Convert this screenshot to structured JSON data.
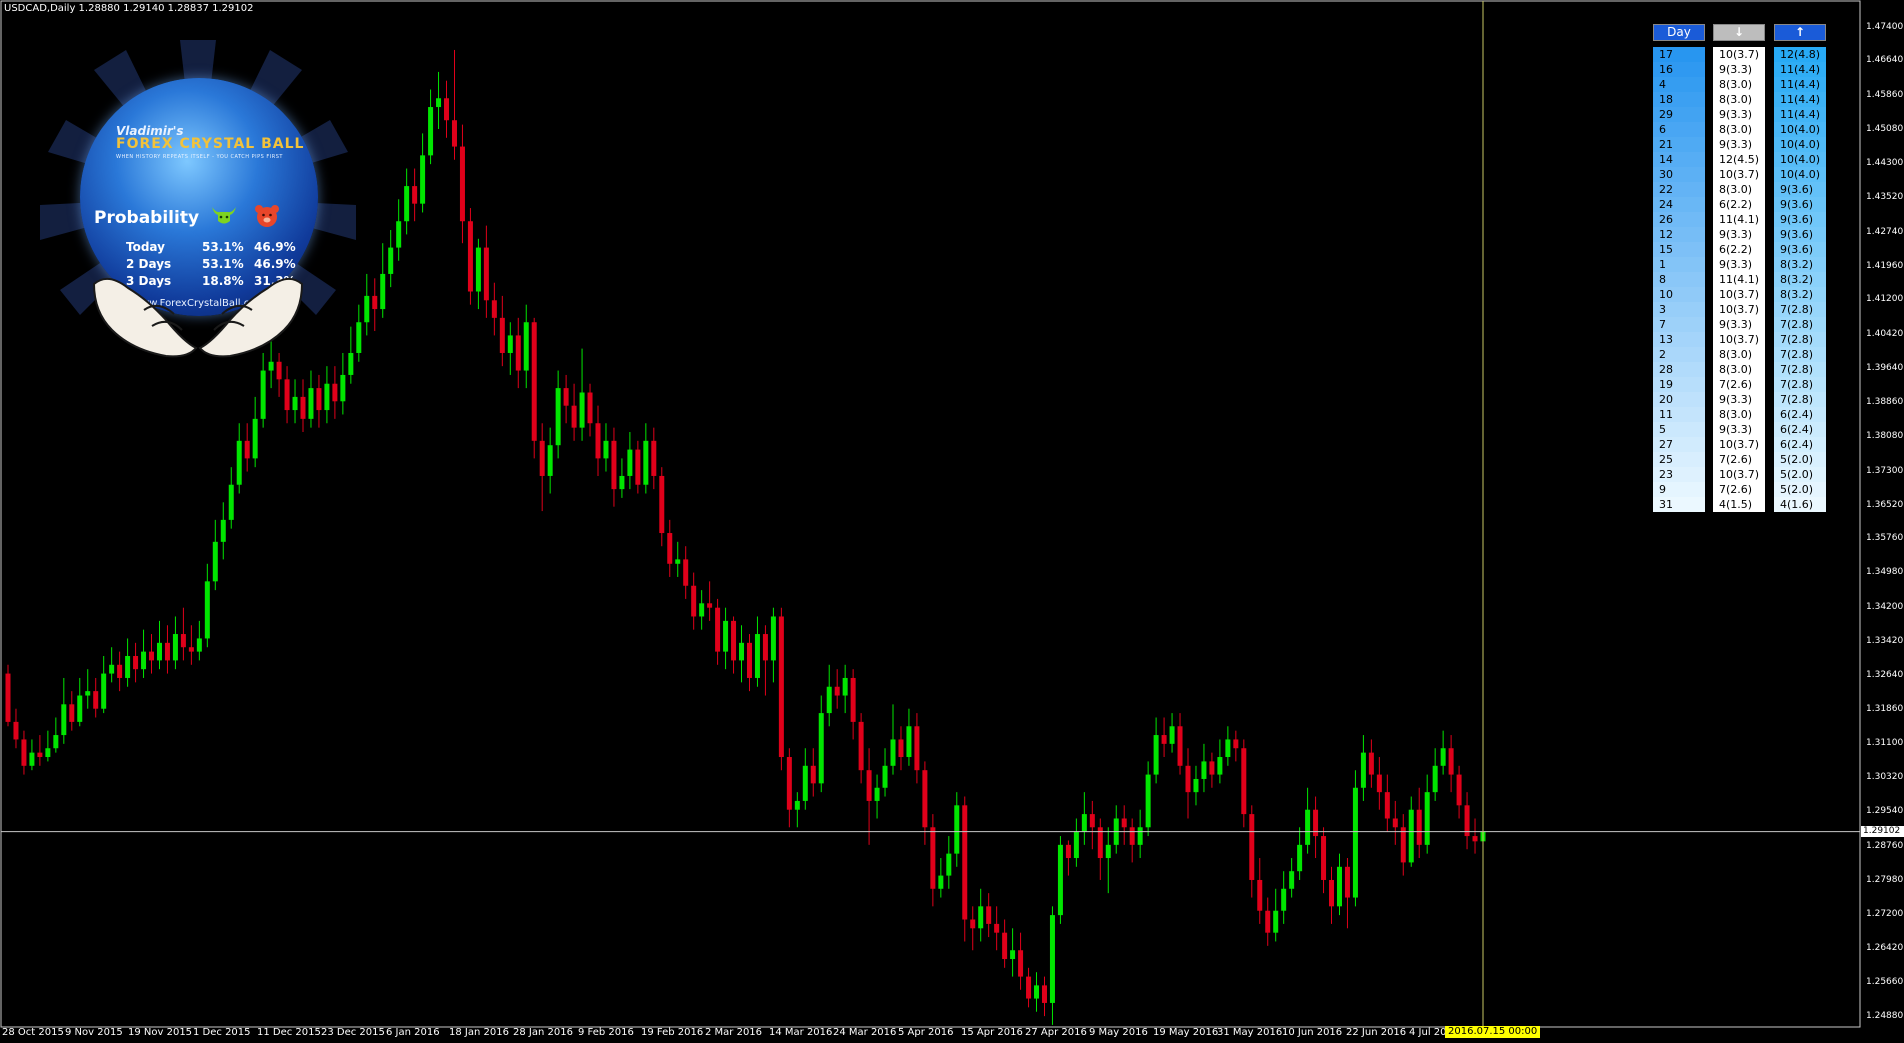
{
  "chart_title": "USDCAD,Daily  1.28880 1.29140 1.28837 1.29102",
  "chart_data": {
    "type": "candlestick",
    "symbol": "USDCAD",
    "timeframe": "Daily",
    "ohlc_header": {
      "open": 1.2888,
      "high": 1.2914,
      "low": 1.28837,
      "close": 1.29102
    },
    "y_ticks": [
      "1.47400",
      "1.46640",
      "1.45860",
      "1.45080",
      "1.44300",
      "1.43520",
      "1.42740",
      "1.41960",
      "1.41200",
      "1.40420",
      "1.39640",
      "1.38860",
      "1.38080",
      "1.37300",
      "1.36520",
      "1.35760",
      "1.34980",
      "1.34200",
      "1.33420",
      "1.32640",
      "1.31860",
      "1.31100",
      "1.30320",
      "1.29540",
      "1.28760",
      "1.27980",
      "1.27200",
      "1.26420",
      "1.25660",
      "1.24880"
    ],
    "ylim": [
      1.2425,
      1.478
    ],
    "x_labels": [
      "28 Oct 2015",
      "9 Nov 2015",
      "19 Nov 2015",
      "1 Dec 2015",
      "11 Dec 2015",
      "23 Dec 2015",
      "6 Jan 2016",
      "18 Jan 2016",
      "28 Jan 2016",
      "9 Feb 2016",
      "19 Feb 2016",
      "2 Mar 2016",
      "14 Mar 2016",
      "24 Mar 2016",
      "5 Apr 2016",
      "15 Apr 2016",
      "27 Apr 2016",
      "9 May 2016",
      "19 May 2016",
      "31 May 2016",
      "10 Jun 2016",
      "22 Jun 2016",
      "4 Jul 20"
    ],
    "current_price_label": "1.29102",
    "current_time_label": "2016.07.15 00:00",
    "colors": {
      "bull": "#00e600",
      "bear": "#e0001a",
      "grid": "#c8c8c8",
      "crosshair": "#c8c864"
    },
    "candles": [
      [
        1.327,
        1.316,
        1.329,
        1.315
      ],
      [
        1.316,
        1.312,
        1.319,
        1.31
      ],
      [
        1.312,
        1.306,
        1.314,
        1.304
      ],
      [
        1.306,
        1.309,
        1.312,
        1.305
      ],
      [
        1.309,
        1.308,
        1.313,
        1.306
      ],
      [
        1.308,
        1.31,
        1.314,
        1.307
      ],
      [
        1.31,
        1.313,
        1.317,
        1.309
      ],
      [
        1.313,
        1.32,
        1.326,
        1.311
      ],
      [
        1.32,
        1.316,
        1.323,
        1.314
      ],
      [
        1.316,
        1.322,
        1.326,
        1.315
      ],
      [
        1.322,
        1.323,
        1.328,
        1.319
      ],
      [
        1.323,
        1.319,
        1.326,
        1.317
      ],
      [
        1.319,
        1.327,
        1.331,
        1.318
      ],
      [
        1.327,
        1.329,
        1.333,
        1.325
      ],
      [
        1.329,
        1.326,
        1.332,
        1.323
      ],
      [
        1.326,
        1.331,
        1.335,
        1.324
      ],
      [
        1.331,
        1.328,
        1.334,
        1.325
      ],
      [
        1.328,
        1.332,
        1.337,
        1.326
      ],
      [
        1.332,
        1.33,
        1.336,
        1.327
      ],
      [
        1.33,
        1.334,
        1.339,
        1.328
      ],
      [
        1.334,
        1.33,
        1.338,
        1.327
      ],
      [
        1.33,
        1.336,
        1.34,
        1.328
      ],
      [
        1.336,
        1.333,
        1.342,
        1.33
      ],
      [
        1.333,
        1.332,
        1.338,
        1.329
      ],
      [
        1.332,
        1.335,
        1.339,
        1.33
      ],
      [
        1.335,
        1.348,
        1.352,
        1.333
      ],
      [
        1.348,
        1.357,
        1.362,
        1.346
      ],
      [
        1.357,
        1.362,
        1.366,
        1.353
      ],
      [
        1.362,
        1.37,
        1.374,
        1.36
      ],
      [
        1.37,
        1.38,
        1.384,
        1.368
      ],
      [
        1.38,
        1.376,
        1.384,
        1.373
      ],
      [
        1.376,
        1.385,
        1.39,
        1.374
      ],
      [
        1.385,
        1.396,
        1.4,
        1.383
      ],
      [
        1.396,
        1.398,
        1.404,
        1.392
      ],
      [
        1.398,
        1.394,
        1.4,
        1.39
      ],
      [
        1.394,
        1.387,
        1.397,
        1.384
      ],
      [
        1.387,
        1.39,
        1.394,
        1.384
      ],
      [
        1.39,
        1.385,
        1.394,
        1.382
      ],
      [
        1.385,
        1.392,
        1.396,
        1.383
      ],
      [
        1.392,
        1.387,
        1.395,
        1.383
      ],
      [
        1.387,
        1.393,
        1.397,
        1.384
      ],
      [
        1.393,
        1.389,
        1.397,
        1.385
      ],
      [
        1.389,
        1.395,
        1.4,
        1.386
      ],
      [
        1.395,
        1.4,
        1.406,
        1.393
      ],
      [
        1.4,
        1.407,
        1.411,
        1.398
      ],
      [
        1.407,
        1.413,
        1.418,
        1.404
      ],
      [
        1.413,
        1.41,
        1.417,
        1.405
      ],
      [
        1.41,
        1.418,
        1.425,
        1.408
      ],
      [
        1.418,
        1.424,
        1.428,
        1.415
      ],
      [
        1.424,
        1.43,
        1.435,
        1.421
      ],
      [
        1.43,
        1.438,
        1.442,
        1.427
      ],
      [
        1.438,
        1.434,
        1.442,
        1.43
      ],
      [
        1.434,
        1.445,
        1.45,
        1.432
      ],
      [
        1.445,
        1.456,
        1.46,
        1.443
      ],
      [
        1.456,
        1.458,
        1.464,
        1.451
      ],
      [
        1.458,
        1.453,
        1.462,
        1.449
      ],
      [
        1.453,
        1.447,
        1.469,
        1.444
      ],
      [
        1.447,
        1.43,
        1.452,
        1.425
      ],
      [
        1.43,
        1.414,
        1.433,
        1.411
      ],
      [
        1.414,
        1.424,
        1.426,
        1.41
      ],
      [
        1.424,
        1.412,
        1.429,
        1.408
      ],
      [
        1.412,
        1.408,
        1.416,
        1.404
      ],
      [
        1.408,
        1.4,
        1.413,
        1.397
      ],
      [
        1.4,
        1.404,
        1.407,
        1.395
      ],
      [
        1.404,
        1.396,
        1.408,
        1.392
      ],
      [
        1.396,
        1.407,
        1.411,
        1.392
      ],
      [
        1.407,
        1.38,
        1.408,
        1.376
      ],
      [
        1.38,
        1.372,
        1.384,
        1.364
      ],
      [
        1.372,
        1.379,
        1.383,
        1.368
      ],
      [
        1.379,
        1.392,
        1.396,
        1.376
      ],
      [
        1.392,
        1.388,
        1.395,
        1.384
      ],
      [
        1.388,
        1.383,
        1.393,
        1.38
      ],
      [
        1.383,
        1.391,
        1.401,
        1.38
      ],
      [
        1.391,
        1.384,
        1.393,
        1.381
      ],
      [
        1.384,
        1.376,
        1.388,
        1.372
      ],
      [
        1.376,
        1.38,
        1.384,
        1.373
      ],
      [
        1.38,
        1.369,
        1.383,
        1.365
      ],
      [
        1.369,
        1.372,
        1.376,
        1.367
      ],
      [
        1.372,
        1.378,
        1.382,
        1.369
      ],
      [
        1.378,
        1.37,
        1.38,
        1.368
      ],
      [
        1.37,
        1.38,
        1.384,
        1.368
      ],
      [
        1.38,
        1.372,
        1.383,
        1.369
      ],
      [
        1.372,
        1.359,
        1.374,
        1.356
      ],
      [
        1.359,
        1.352,
        1.362,
        1.349
      ],
      [
        1.352,
        1.353,
        1.357,
        1.349
      ],
      [
        1.353,
        1.347,
        1.356,
        1.344
      ],
      [
        1.347,
        1.34,
        1.35,
        1.337
      ],
      [
        1.34,
        1.343,
        1.346,
        1.337
      ],
      [
        1.343,
        1.342,
        1.348,
        1.339
      ],
      [
        1.342,
        1.332,
        1.344,
        1.329
      ],
      [
        1.332,
        1.339,
        1.342,
        1.328
      ],
      [
        1.339,
        1.33,
        1.34,
        1.327
      ],
      [
        1.33,
        1.334,
        1.338,
        1.325
      ],
      [
        1.334,
        1.326,
        1.336,
        1.323
      ],
      [
        1.326,
        1.336,
        1.34,
        1.324
      ],
      [
        1.336,
        1.33,
        1.338,
        1.322
      ],
      [
        1.33,
        1.34,
        1.342,
        1.325
      ],
      [
        1.34,
        1.308,
        1.342,
        1.305
      ],
      [
        1.308,
        1.296,
        1.31,
        1.292
      ],
      [
        1.296,
        1.298,
        1.3,
        1.292
      ],
      [
        1.298,
        1.306,
        1.31,
        1.296
      ],
      [
        1.306,
        1.302,
        1.31,
        1.299
      ],
      [
        1.302,
        1.318,
        1.322,
        1.3
      ],
      [
        1.318,
        1.324,
        1.329,
        1.315
      ],
      [
        1.324,
        1.322,
        1.328,
        1.319
      ],
      [
        1.322,
        1.326,
        1.329,
        1.318
      ],
      [
        1.326,
        1.316,
        1.328,
        1.312
      ],
      [
        1.316,
        1.305,
        1.318,
        1.302
      ],
      [
        1.305,
        1.298,
        1.31,
        1.288
      ],
      [
        1.298,
        1.301,
        1.304,
        1.294
      ],
      [
        1.301,
        1.306,
        1.31,
        1.299
      ],
      [
        1.306,
        1.312,
        1.32,
        1.304
      ],
      [
        1.312,
        1.308,
        1.315,
        1.305
      ],
      [
        1.308,
        1.315,
        1.319,
        1.306
      ],
      [
        1.315,
        1.305,
        1.318,
        1.302
      ],
      [
        1.305,
        1.292,
        1.307,
        1.288
      ],
      [
        1.292,
        1.278,
        1.295,
        1.274
      ],
      [
        1.278,
        1.281,
        1.285,
        1.276
      ],
      [
        1.281,
        1.286,
        1.29,
        1.278
      ],
      [
        1.286,
        1.297,
        1.3,
        1.283
      ],
      [
        1.297,
        1.271,
        1.299,
        1.266
      ],
      [
        1.271,
        1.269,
        1.274,
        1.264
      ],
      [
        1.269,
        1.274,
        1.278,
        1.266
      ],
      [
        1.274,
        1.27,
        1.277,
        1.267
      ],
      [
        1.27,
        1.268,
        1.274,
        1.264
      ],
      [
        1.268,
        1.262,
        1.271,
        1.26
      ],
      [
        1.262,
        1.264,
        1.269,
        1.258
      ],
      [
        1.264,
        1.258,
        1.268,
        1.255
      ],
      [
        1.258,
        1.253,
        1.26,
        1.251
      ],
      [
        1.253,
        1.256,
        1.259,
        1.25
      ],
      [
        1.256,
        1.252,
        1.258,
        1.249
      ],
      [
        1.252,
        1.272,
        1.274,
        1.247
      ],
      [
        1.272,
        1.288,
        1.29,
        1.27
      ],
      [
        1.288,
        1.285,
        1.289,
        1.281
      ],
      [
        1.285,
        1.291,
        1.294,
        1.283
      ],
      [
        1.291,
        1.295,
        1.3,
        1.288
      ],
      [
        1.295,
        1.292,
        1.298,
        1.287
      ],
      [
        1.292,
        1.285,
        1.294,
        1.28
      ],
      [
        1.285,
        1.288,
        1.292,
        1.277
      ],
      [
        1.288,
        1.294,
        1.297,
        1.286
      ],
      [
        1.294,
        1.292,
        1.297,
        1.288
      ],
      [
        1.292,
        1.288,
        1.294,
        1.284
      ],
      [
        1.288,
        1.292,
        1.296,
        1.285
      ],
      [
        1.292,
        1.304,
        1.307,
        1.29
      ],
      [
        1.304,
        1.313,
        1.317,
        1.302
      ],
      [
        1.313,
        1.311,
        1.317,
        1.308
      ],
      [
        1.311,
        1.315,
        1.318,
        1.309
      ],
      [
        1.315,
        1.306,
        1.318,
        1.304
      ],
      [
        1.306,
        1.3,
        1.31,
        1.294
      ],
      [
        1.3,
        1.303,
        1.306,
        1.297
      ],
      [
        1.303,
        1.307,
        1.311,
        1.3
      ],
      [
        1.307,
        1.304,
        1.309,
        1.301
      ],
      [
        1.304,
        1.308,
        1.312,
        1.302
      ],
      [
        1.308,
        1.312,
        1.315,
        1.306
      ],
      [
        1.312,
        1.31,
        1.314,
        1.307
      ],
      [
        1.31,
        1.295,
        1.312,
        1.292
      ],
      [
        1.295,
        1.28,
        1.297,
        1.276
      ],
      [
        1.28,
        1.273,
        1.285,
        1.27
      ],
      [
        1.273,
        1.268,
        1.276,
        1.265
      ],
      [
        1.268,
        1.273,
        1.278,
        1.266
      ],
      [
        1.273,
        1.278,
        1.282,
        1.27
      ],
      [
        1.278,
        1.282,
        1.285,
        1.276
      ],
      [
        1.282,
        1.288,
        1.292,
        1.28
      ],
      [
        1.288,
        1.296,
        1.301,
        1.286
      ],
      [
        1.296,
        1.29,
        1.299,
        1.285
      ],
      [
        1.29,
        1.28,
        1.292,
        1.277
      ],
      [
        1.28,
        1.274,
        1.283,
        1.27
      ],
      [
        1.274,
        1.283,
        1.286,
        1.272
      ],
      [
        1.283,
        1.276,
        1.285,
        1.269
      ],
      [
        1.276,
        1.301,
        1.305,
        1.274
      ],
      [
        1.301,
        1.309,
        1.313,
        1.298
      ],
      [
        1.309,
        1.304,
        1.312,
        1.301
      ],
      [
        1.304,
        1.3,
        1.308,
        1.296
      ],
      [
        1.3,
        1.294,
        1.304,
        1.291
      ],
      [
        1.294,
        1.292,
        1.298,
        1.288
      ],
      [
        1.292,
        1.284,
        1.295,
        1.281
      ],
      [
        1.284,
        1.296,
        1.299,
        1.283
      ],
      [
        1.296,
        1.288,
        1.301,
        1.285
      ],
      [
        1.288,
        1.3,
        1.304,
        1.286
      ],
      [
        1.3,
        1.306,
        1.31,
        1.298
      ],
      [
        1.306,
        1.31,
        1.314,
        1.304
      ],
      [
        1.31,
        1.304,
        1.313,
        1.3
      ],
      [
        1.304,
        1.297,
        1.306,
        1.294
      ],
      [
        1.297,
        1.29,
        1.3,
        1.287
      ],
      [
        1.29,
        1.2888,
        1.294,
        1.286
      ],
      [
        1.2888,
        1.29102,
        1.2914,
        1.28837
      ]
    ]
  },
  "stats": {
    "headers": {
      "day": "Day",
      "down": "↓",
      "up": "↑"
    },
    "day": [
      "17",
      "16",
      "4",
      "18",
      "29",
      "6",
      "21",
      "14",
      "30",
      "22",
      "24",
      "26",
      "12",
      "15",
      "1",
      "8",
      "10",
      "3",
      "7",
      "13",
      "2",
      "28",
      "19",
      "20",
      "11",
      "5",
      "27",
      "25",
      "23",
      "9",
      "31"
    ],
    "down": [
      "10(3.7)",
      "9(3.3)",
      "8(3.0)",
      "8(3.0)",
      "9(3.3)",
      "8(3.0)",
      "9(3.3)",
      "12(4.5)",
      "10(3.7)",
      "8(3.0)",
      "6(2.2)",
      "11(4.1)",
      "9(3.3)",
      "6(2.2)",
      "9(3.3)",
      "11(4.1)",
      "10(3.7)",
      "10(3.7)",
      "9(3.3)",
      "10(3.7)",
      "8(3.0)",
      "8(3.0)",
      "7(2.6)",
      "9(3.3)",
      "8(3.0)",
      "9(3.3)",
      "10(3.7)",
      "7(2.6)",
      "10(3.7)",
      "7(2.6)",
      "4(1.5)"
    ],
    "up": [
      "12(4.8)",
      "11(4.4)",
      "11(4.4)",
      "11(4.4)",
      "11(4.4)",
      "10(4.0)",
      "10(4.0)",
      "10(4.0)",
      "10(4.0)",
      "9(3.6)",
      "9(3.6)",
      "9(3.6)",
      "9(3.6)",
      "9(3.6)",
      "8(3.2)",
      "8(3.2)",
      "8(3.2)",
      "7(2.8)",
      "7(2.8)",
      "7(2.8)",
      "7(2.8)",
      "7(2.8)",
      "7(2.8)",
      "7(2.8)",
      "6(2.4)",
      "6(2.4)",
      "6(2.4)",
      "5(2.0)",
      "5(2.0)",
      "5(2.0)",
      "4(1.6)"
    ]
  },
  "ball": {
    "author": "Vladimir's",
    "brand": "FOREX CRYSTAL BALL",
    "tagline": "WHEN HISTORY REPEATS ITSELF - YOU CATCH PIPS FIRST",
    "probability_label": "Probability",
    "rows": [
      {
        "label": "Today",
        "bull": "53.1%",
        "bear": "46.9%"
      },
      {
        "label": "2 Days",
        "bull": "53.1%",
        "bear": "46.9%"
      },
      {
        "label": "3 Days",
        "bull": "18.8%",
        "bear": "31.3%"
      }
    ],
    "url": "www.ForexCrystalBall.com",
    "icons": {
      "bull": "bull-icon",
      "bear": "bear-icon"
    }
  }
}
